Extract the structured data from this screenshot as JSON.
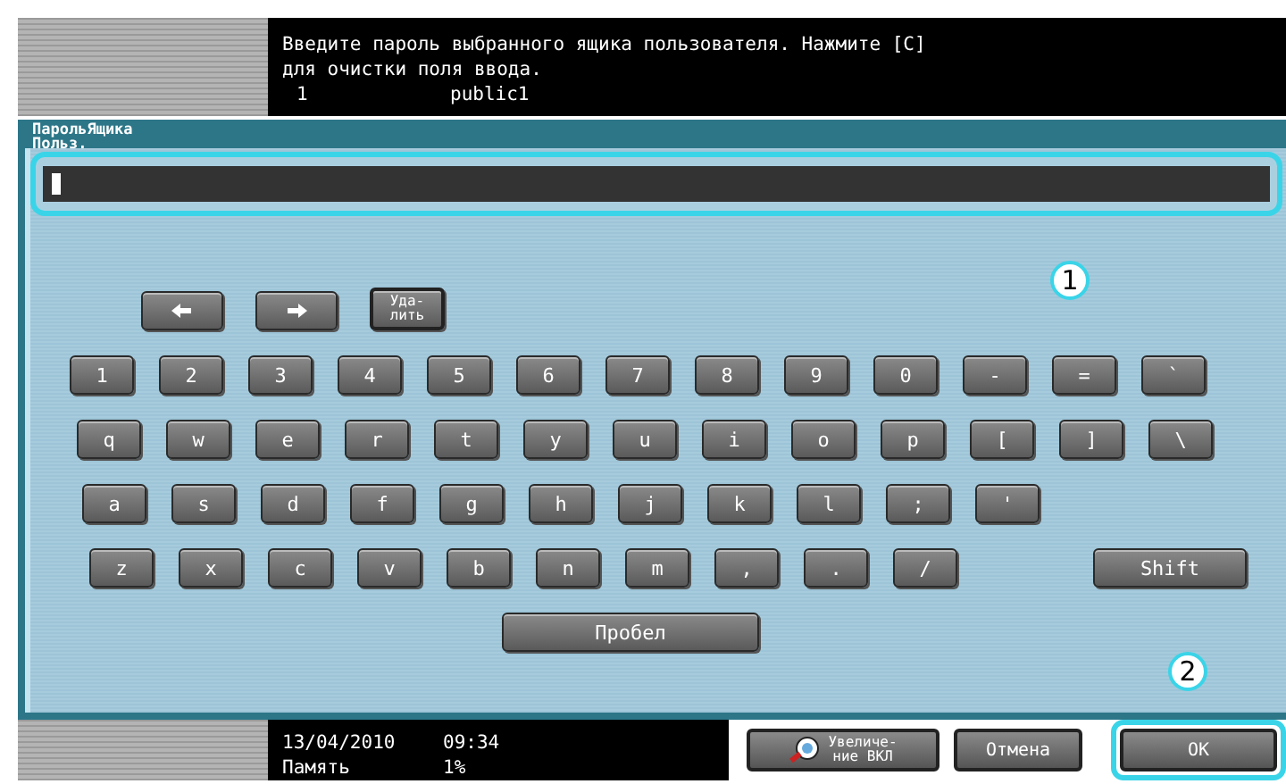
{
  "message": {
    "lines": [
      "Введите пароль выбранного ящика пользователя. Нажмите [C]",
      "для очистки поля ввода."
    ],
    "box_number": "1",
    "box_name": "public1"
  },
  "dialog": {
    "title_lines": [
      "ПарольЯщика",
      "Польз."
    ],
    "nav_keys": [
      {
        "kind": "left"
      },
      {
        "kind": "right"
      },
      {
        "kind": "text",
        "label_lines": [
          "Уда-",
          "лить"
        ]
      }
    ],
    "key_rows": [
      [
        "1",
        "2",
        "3",
        "4",
        "5",
        "6",
        "7",
        "8",
        "9",
        "0",
        "-",
        "=",
        "`"
      ],
      [
        "q",
        "w",
        "e",
        "r",
        "t",
        "y",
        "u",
        "i",
        "o",
        "p",
        "[",
        "]",
        "\\"
      ],
      [
        "a",
        "s",
        "d",
        "f",
        "g",
        "h",
        "j",
        "k",
        "l",
        ";",
        "'"
      ],
      [
        "z",
        "x",
        "c",
        "v",
        "b",
        "n",
        "m",
        ",",
        ".",
        "/"
      ]
    ],
    "shift_key": "Shift",
    "space_key": "Пробел"
  },
  "callouts": [
    "1",
    "2"
  ],
  "status": {
    "date": "13/04/2010",
    "time": "09:34",
    "memory_label": "Память",
    "memory_value": "1%"
  },
  "buttons": {
    "zoom": [
      "Увеличе-",
      "ние ВКЛ"
    ],
    "cancel": "Отмена",
    "ok": "OK"
  }
}
